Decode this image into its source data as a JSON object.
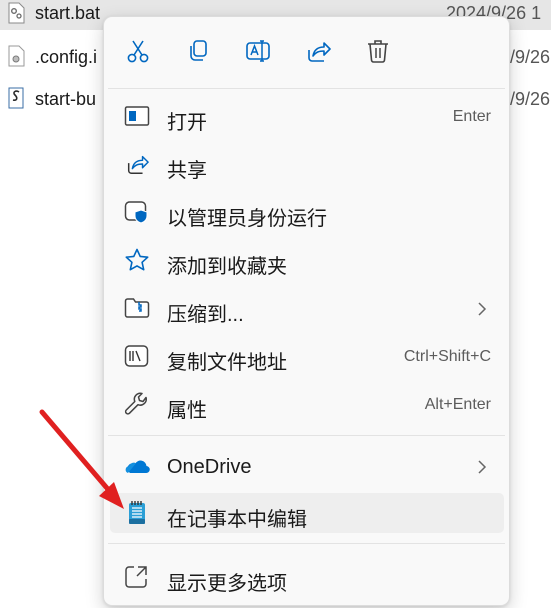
{
  "explorer": {
    "files": [
      {
        "name": "start.bat",
        "date": "2024/9/26 1",
        "icon": "batch-file-icon"
      },
      {
        "name": ".config.i",
        "date": "/9/26 1",
        "icon": "config-file-icon"
      },
      {
        "name": "start-bu",
        "date": "/9/26 1",
        "icon": "script-file-icon"
      }
    ]
  },
  "menu": {
    "toolbar": [
      {
        "name": "cut",
        "icon": "scissors-icon"
      },
      {
        "name": "copy",
        "icon": "copy-icon"
      },
      {
        "name": "rename",
        "icon": "rename-icon"
      },
      {
        "name": "share",
        "icon": "share-icon"
      },
      {
        "name": "delete",
        "icon": "trash-icon"
      }
    ],
    "items": [
      {
        "label": "打开",
        "shortcut": "Enter",
        "icon": "open-window-icon"
      },
      {
        "label": "共享",
        "shortcut": "",
        "icon": "share-icon"
      },
      {
        "label": "以管理员身份运行",
        "shortcut": "",
        "icon": "shield-window-icon"
      },
      {
        "label": "添加到收藏夹",
        "shortcut": "",
        "icon": "star-icon"
      },
      {
        "label": "压缩到...",
        "shortcut": "",
        "icon": "zip-folder-icon",
        "submenu": true
      },
      {
        "label": "复制文件地址",
        "shortcut": "Ctrl+Shift+C",
        "icon": "copy-path-icon"
      },
      {
        "label": "属性",
        "shortcut": "Alt+Enter",
        "icon": "wrench-icon"
      },
      {
        "label": "OneDrive",
        "shortcut": "",
        "icon": "onedrive-cloud-icon",
        "submenu": true
      },
      {
        "label": "在记事本中编辑",
        "shortcut": "",
        "icon": "notepad-icon",
        "hovered": true
      },
      {
        "label": "显示更多选项",
        "shortcut": "",
        "icon": "show-more-options-icon"
      }
    ]
  },
  "colors": {
    "accent": "#0067c0",
    "onedrive": "#0078d4",
    "arrow": "#e02020"
  }
}
